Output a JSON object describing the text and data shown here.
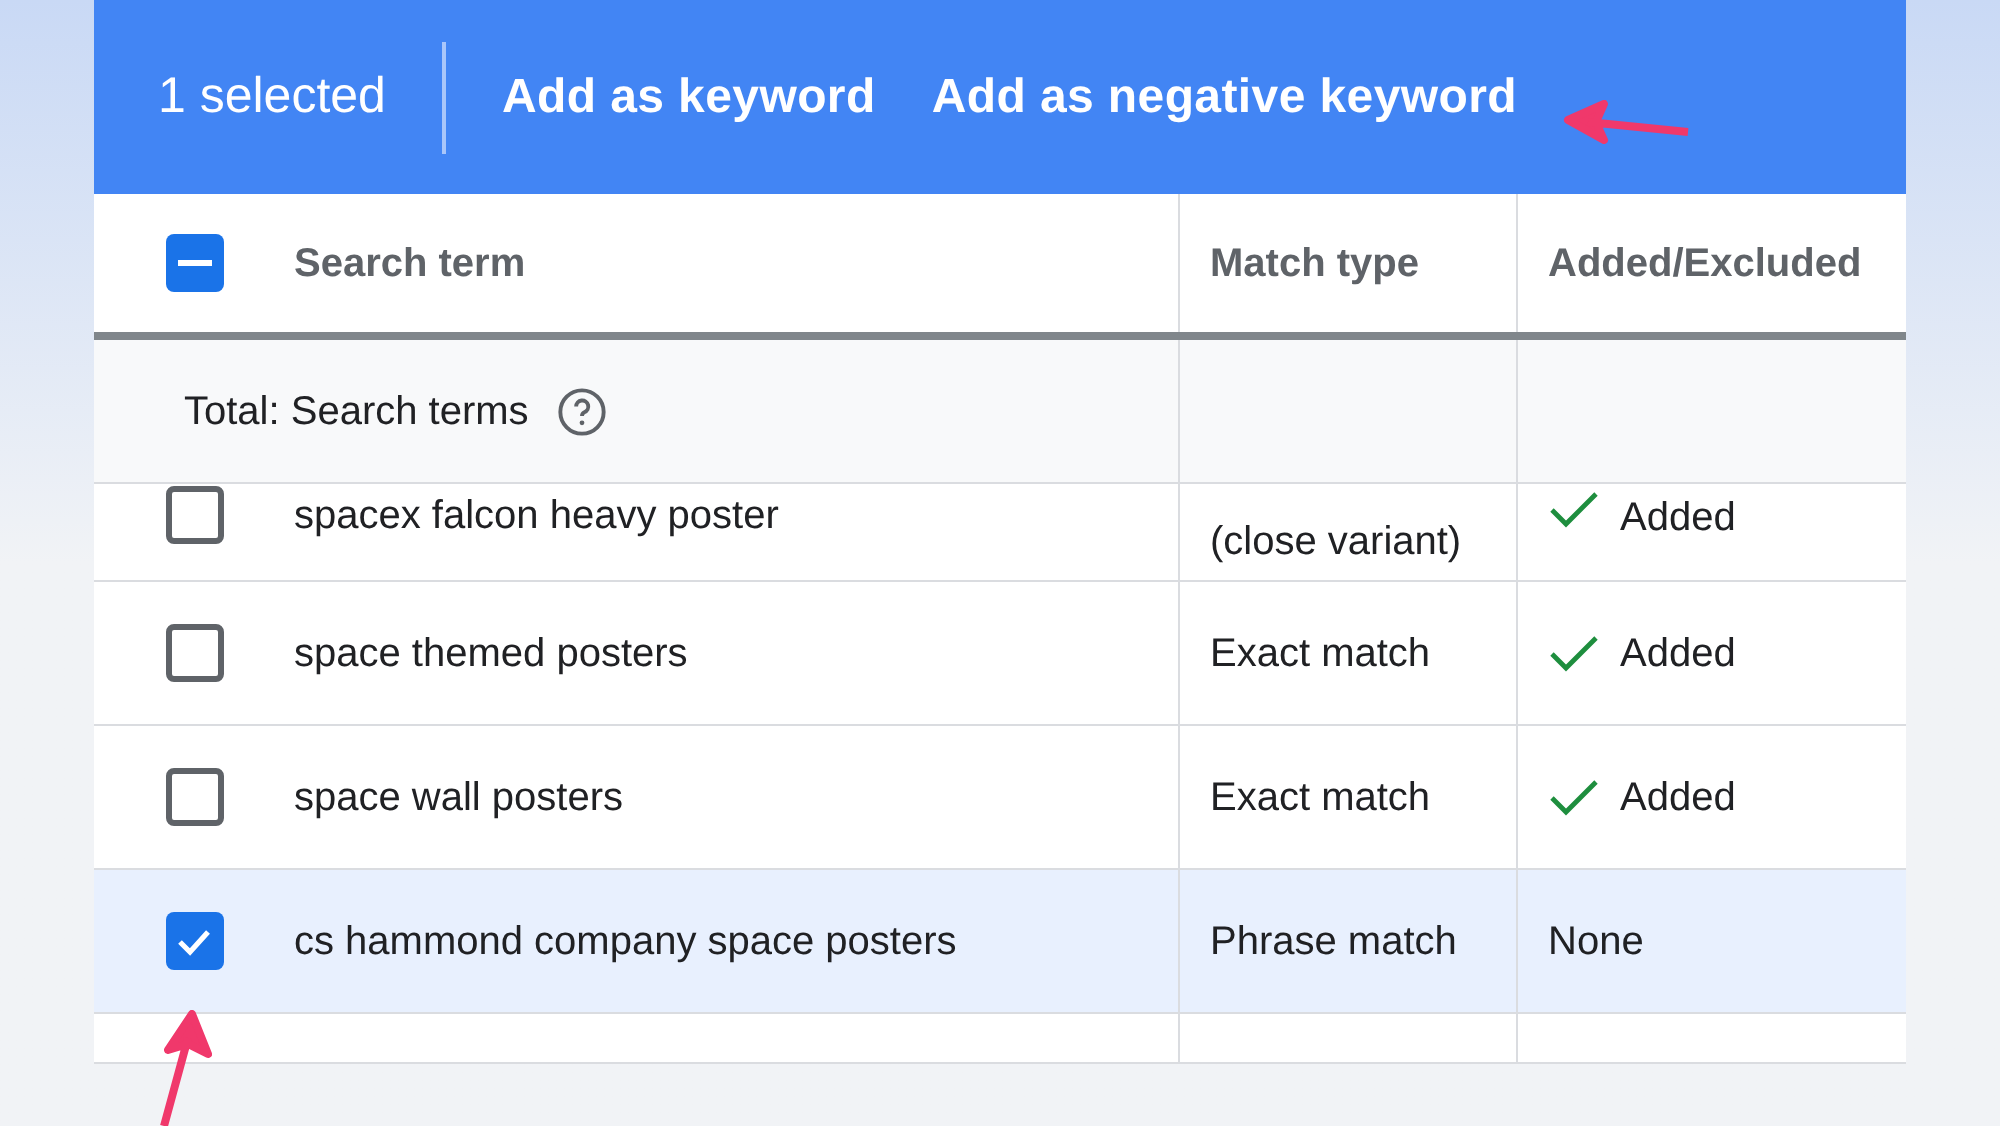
{
  "action_bar": {
    "selection_count": "1 selected",
    "actions": [
      "Add as keyword",
      "Add as negative keyword"
    ]
  },
  "table": {
    "header_checkbox": {
      "indeterminate": true
    },
    "columns": [
      "Search term",
      "Match type",
      "Added/Excluded"
    ],
    "total_row": {
      "label": "Total: Search terms"
    },
    "rows": [
      {
        "term": "spacex falcon heavy poster",
        "match_type": "(close variant)",
        "status": "Added",
        "added": true,
        "selected": false,
        "partial": true
      },
      {
        "term": "space themed posters",
        "match_type": "Exact match",
        "status": "Added",
        "added": true,
        "selected": false,
        "partial": false
      },
      {
        "term": "space wall posters",
        "match_type": "Exact match",
        "status": "Added",
        "added": true,
        "selected": false,
        "partial": false
      },
      {
        "term": "cs hammond company space posters",
        "match_type": "Phrase match",
        "status": "None",
        "added": false,
        "selected": true,
        "partial": false
      }
    ]
  }
}
